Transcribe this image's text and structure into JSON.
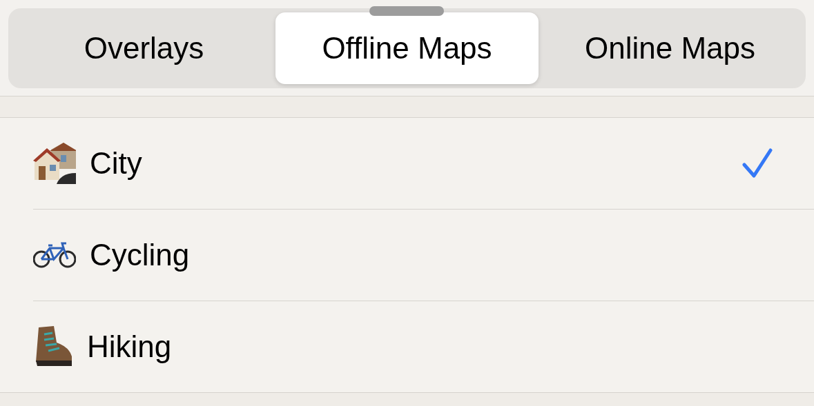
{
  "tabs": [
    {
      "label": "Overlays",
      "selected": false
    },
    {
      "label": "Offline Maps",
      "selected": true
    },
    {
      "label": "Online Maps",
      "selected": false
    }
  ],
  "maps": [
    {
      "kind": "city",
      "name": "City",
      "checked": true
    },
    {
      "kind": "cycling",
      "name": "Cycling",
      "checked": false
    },
    {
      "kind": "hiking",
      "name": "Hiking",
      "checked": false
    }
  ]
}
